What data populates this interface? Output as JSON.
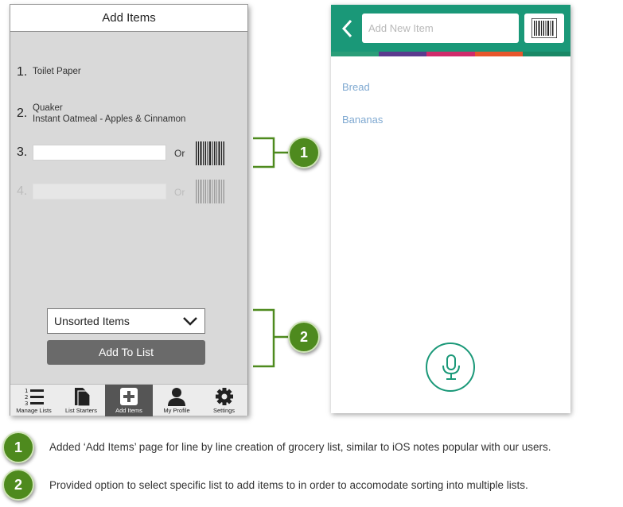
{
  "left_screen": {
    "title": "Add Items",
    "items": [
      {
        "num": "1.",
        "name": "Toilet Paper",
        "sub": ""
      },
      {
        "num": "2.",
        "name": "Quaker",
        "sub": "Instant Oatmeal - Apples & Cinnamon"
      }
    ],
    "entry_rows": [
      {
        "num": "3.",
        "or": "Or"
      },
      {
        "num": "4.",
        "or": "Or"
      }
    ],
    "list_select": {
      "selected": "Unsorted Items"
    },
    "add_button": "Add To List",
    "tabs": [
      {
        "label": "Manage Lists",
        "icon": "list-icon"
      },
      {
        "label": "List Starters",
        "icon": "documents-icon"
      },
      {
        "label": "Add Items",
        "icon": "plus-icon"
      },
      {
        "label": "My Profile",
        "icon": "person-icon"
      },
      {
        "label": "Settings",
        "icon": "gear-icon"
      }
    ]
  },
  "right_screen": {
    "search_placeholder": "Add New Item",
    "items": [
      "Bread",
      "Bananas"
    ],
    "colorbar": [
      "#2a9d78",
      "#5b3a8e",
      "#d02b6b",
      "#e8562c",
      "#1a8866"
    ],
    "accent": "#1a9878"
  },
  "callouts": [
    {
      "num": "1",
      "text": "Added ‘Add Items’ page for line by line creation of grocery list, similar to iOS notes popular with our users."
    },
    {
      "num": "2",
      "text": "Provided option to select specific list to add items to in order to accomodate sorting into multiple lists."
    }
  ],
  "colors": {
    "callout_green": "#4e8a1e",
    "teal": "#1a9878"
  }
}
